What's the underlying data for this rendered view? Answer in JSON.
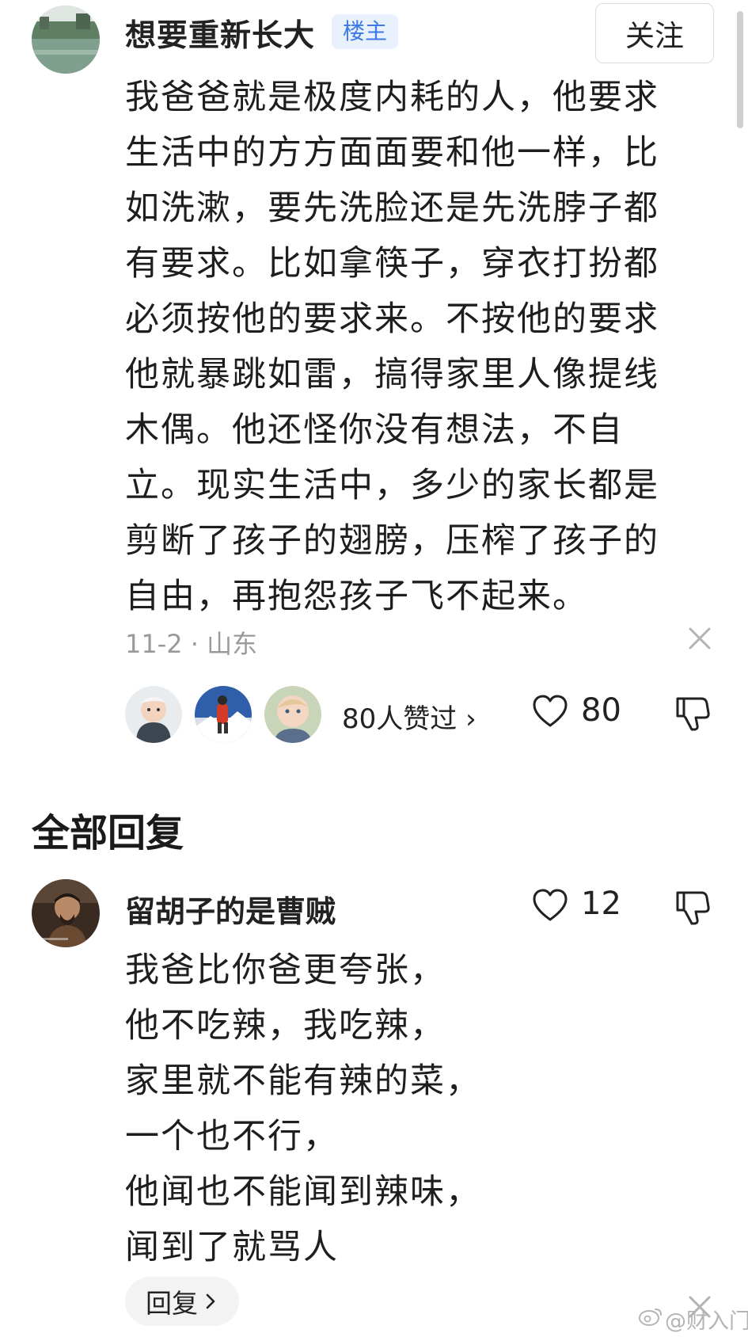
{
  "post": {
    "author_name": "想要重新长大",
    "author_badge": "楼主",
    "follow_label": "关注",
    "body": "我爸爸就是极度内耗的人，他要求\n生活中的方方面面要和他一样，比\n如洗漱，要先洗脸还是先洗脖子都\n有要求。比如拿筷子，穿衣打扮都\n必须按他的要求来。不按他的要求\n他就暴跳如雷，搞得家里人像提线\n木偶。他还怪你没有想法，不自\n立。现实生活中，多少的家长都是\n剪断了孩子的翅膀，压榨了孩子的\n自由，再抱怨孩子飞不起来。",
    "meta": "11-2 · 山东",
    "likers_text": "80人赞过 ›",
    "like_count": "80",
    "close_icon": "close-icon",
    "like_icon": "heart-icon",
    "dislike_icon": "thumbs-down-icon"
  },
  "section": {
    "title": "全部回复"
  },
  "reply": {
    "author_name": "留胡子的是曹贼",
    "like_count": "12",
    "body": "我爸比你爸更夸张，\n他不吃辣，我吃辣，\n家里就不能有辣的菜，\n一个也不行，\n他闻也不能闻到辣味，\n闻到了就骂人",
    "reply_button_label": "回复",
    "reply_button_icon": "chevron-right-icon"
  },
  "watermark": {
    "text": "@财入门",
    "icon": "weibo-logo-icon"
  },
  "colors": {
    "text": "#1e1e1e",
    "meta_gray": "#9a9a9a",
    "badge_bg": "#e9f1fd",
    "badge_text": "#3d7ae6",
    "reply_button_bg": "#f3f3f3"
  }
}
